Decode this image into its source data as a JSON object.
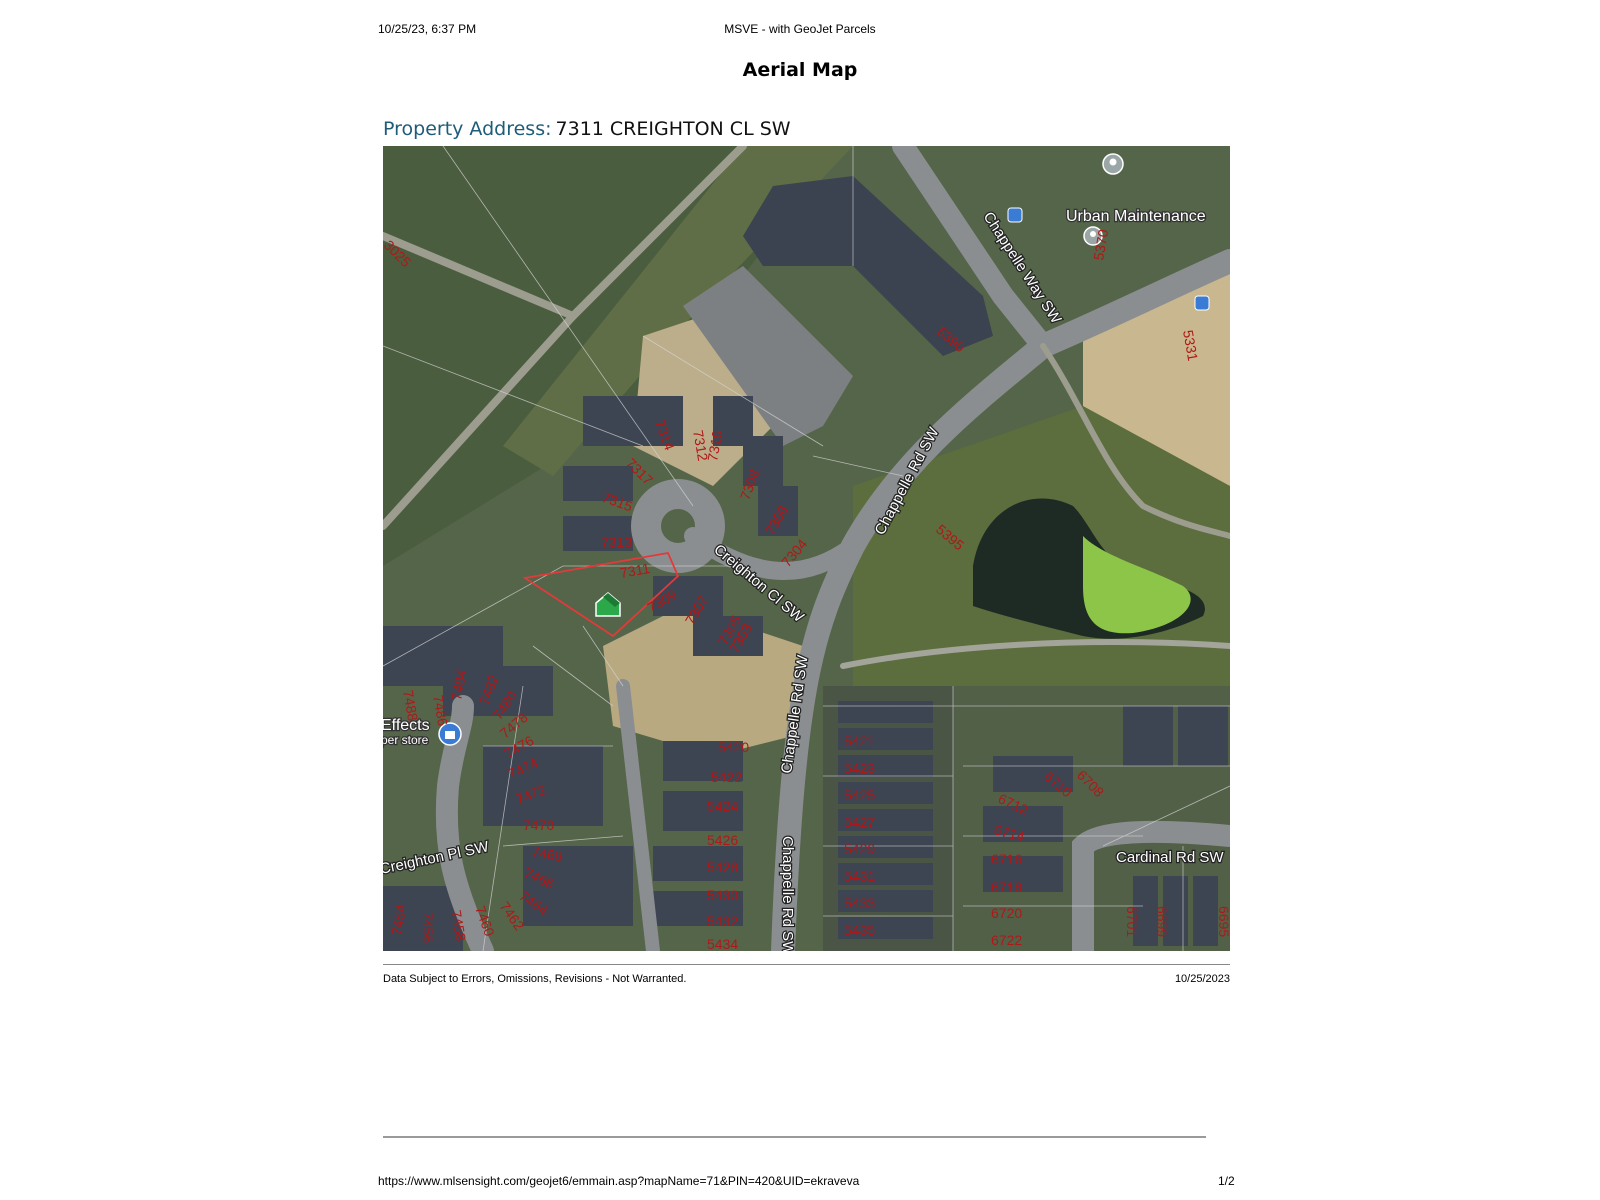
{
  "header": {
    "datetime": "10/25/23, 6:37 PM",
    "window_title": "MSVE - with GeoJet Parcels"
  },
  "page": {
    "title": "Aerial Map",
    "address_label": "Property Address:",
    "address_value": "7311 CREIGHTON CL SW"
  },
  "map": {
    "streets": [
      "Chappelle Way SW",
      "Chappelle Rd SW",
      "Creighton Cl SW",
      "Chappelle Rd SW",
      "Creighton Pl SW",
      "Cardinal Rd SW"
    ],
    "poi": [
      "Urban Maintenance",
      "Effects",
      "per store"
    ],
    "lots": [
      "3025",
      "5370",
      "5331",
      "5390",
      "5395",
      "7314",
      "7312",
      "7310",
      "7317",
      "7315",
      "7308",
      "7306",
      "7313",
      "7304",
      "7311",
      "7309",
      "7307",
      "7305",
      "7303",
      "7484",
      "7486",
      "7488",
      "7482",
      "7480",
      "7478",
      "7476",
      "7474",
      "7472",
      "7470",
      "7468",
      "7466",
      "7464",
      "7462",
      "7460",
      "7458",
      "7456",
      "7454",
      "5420",
      "5422",
      "5424",
      "5426",
      "5428",
      "5430",
      "5432",
      "5434",
      "5421",
      "5423",
      "5425",
      "5427",
      "5429",
      "5431",
      "5433",
      "5435",
      "6710",
      "6708",
      "6712",
      "6714",
      "6716",
      "6718",
      "6720",
      "6722",
      "6701",
      "6699",
      "6695"
    ],
    "colors": {
      "road": "#8a8d8f",
      "parcel_line": "#d9d9d9",
      "subject_parcel": "#e23a3a",
      "roof": "#3d4452",
      "grass": "#5a6b45",
      "dirt": "#c7b596",
      "pond": "#1f2b25",
      "algae": "#8fc84a",
      "marker": "#2aa84a"
    }
  },
  "footer": {
    "disclaimer": "Data Subject to Errors, Omissions, Revisions - Not Warranted.",
    "date": "10/25/2023",
    "url": "https://www.mlsensight.com/geojet6/emmain.asp?mapName=71&PIN=420&UID=ekraveva",
    "page_number": "1/2"
  }
}
